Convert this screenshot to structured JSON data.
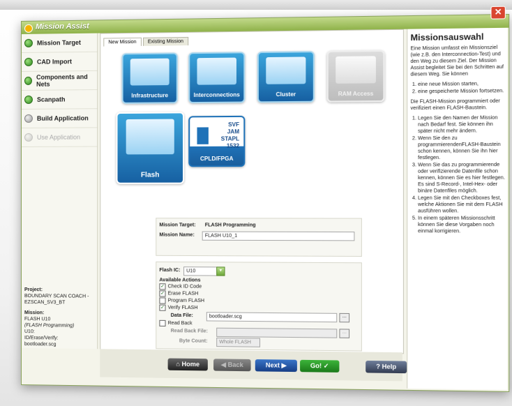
{
  "window": {
    "title": "Mission Assist",
    "close_label": "✕"
  },
  "sidebar": {
    "items": [
      {
        "label": "Mission Target",
        "state": "done"
      },
      {
        "label": "CAD Import",
        "state": "done"
      },
      {
        "label": "Components and Nets",
        "state": "done"
      },
      {
        "label": "Scanpath",
        "state": "done"
      },
      {
        "label": "Build Application",
        "state": "pending"
      },
      {
        "label": "Use Application",
        "state": "disabled"
      }
    ],
    "project_heading": "Project:",
    "project_name": "BOUNDARY SCAN COACH - EZSCAN_SV3_BT",
    "mission_heading": "Mission:",
    "mission_line1": "FLASH U10",
    "mission_line2": "(FLASH Programming)",
    "mission_line3": "U10:",
    "mission_line4": "ID/Erase/Verify:",
    "mission_line5": "bootloader.scg"
  },
  "tabs": [
    "New Mission",
    "Existing Mission"
  ],
  "tiles": {
    "infrastructure": "Infrastructure",
    "interconnections": "Interconnections",
    "cluster": "Cluster",
    "ram_access": "RAM Access",
    "flash": "Flash",
    "cpld": "CPLD/FPGA",
    "cpld_formats": [
      "SVF",
      "JAM",
      "STAPL",
      "1532"
    ]
  },
  "mission_panel": {
    "target_label": "Mission Target:",
    "target_value": "FLASH Programming",
    "name_label": "Mission Name:",
    "name_value": "FLASH U10_1"
  },
  "flash_panel": {
    "ic_label": "Flash IC:",
    "ic_value": "U10",
    "actions_heading": "Available Actions",
    "actions": [
      {
        "label": "Check ID Code",
        "checked": true
      },
      {
        "label": "Erase FLASH",
        "checked": true
      },
      {
        "label": "Program FLASH",
        "checked": false
      },
      {
        "label": "Verify FLASH",
        "checked": true
      }
    ],
    "data_file_label": "Data File:",
    "data_file_value": "bootloader.scg",
    "read_back_label": "Read Back",
    "read_back_checked": false,
    "read_back_file_label": "Read Back File:",
    "byte_count_label": "Byte Count:",
    "byte_count_value": "Whole FLASH",
    "browse_label": "..."
  },
  "buttons": {
    "home": "Home",
    "back": "Back",
    "next": "Next",
    "go": "Go!",
    "help": "Help"
  },
  "help": {
    "title": "Missionsauswahl",
    "intro": "Eine Mission umfasst ein Missionsziel (wie z.B. den Interconnection-Test) und den Weg zu diesem Ziel. Der Mission Assist begleitet Sie bei den Schritten auf diesem Weg. Sie können",
    "intro_items": [
      "eine neue Mission starten,",
      "eine gespeicherte Mission fortsetzen."
    ],
    "flash_intro": "Die FLASH-Mission programmiert oder verifiziert einen FLASH-Baustein.",
    "flash_items": [
      "Legen Sie den Namen der Mission nach Bedarf fest. Sie können ihn später nicht mehr ändern.",
      "Wenn Sie den zu programmierendenFLASH-Baustein schon kennen, können Sie ihn hier festlegen.",
      "Wenn Sie das zu programmierende oder verifizierende Datenfile schon kennen, können Sie es hier festlegen. Es sind S-Record-, Intel-Hex- oder binäre Datenfiles möglich.",
      "Legen Sie mit den Checkboxes fest, welche Aktionen Sie mit dem FLASH ausführen wollen.",
      "In einem späteren Missionsschritt können Sie diese Vorgaben noch einmal korrigieren."
    ]
  }
}
